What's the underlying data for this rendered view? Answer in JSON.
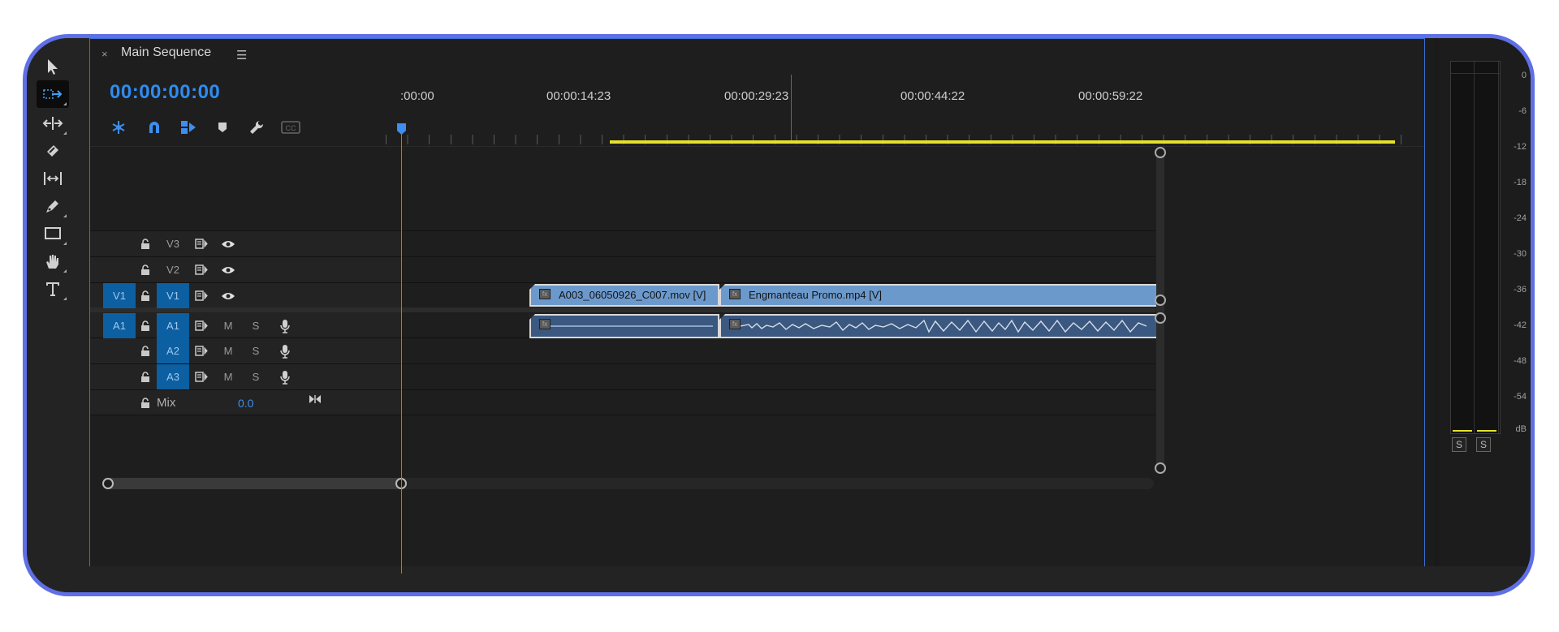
{
  "panel": {
    "close": "×",
    "title": "Main Sequence",
    "menu": "☰"
  },
  "timecode": "00:00:00:00",
  "ruler": {
    "ticks": [
      ":00:00",
      "00:00:14:23",
      "00:00:29:23",
      "00:00:44:22",
      "00:00:59:22"
    ]
  },
  "tracks": {
    "V3": {
      "label": "V3"
    },
    "V2": {
      "label": "V2"
    },
    "V1": {
      "src": "V1",
      "label": "V1"
    },
    "A1": {
      "src": "A1",
      "label": "A1",
      "m": "M",
      "s": "S"
    },
    "A2": {
      "label": "A2",
      "m": "M",
      "s": "S"
    },
    "A3": {
      "label": "A3",
      "m": "M",
      "s": "S"
    },
    "mix": {
      "label": "Mix",
      "value": "0.0"
    }
  },
  "clips": {
    "video": [
      {
        "name": "A003_06050926_C007.mov [V]"
      },
      {
        "name": "Engmanteau Promo.mp4 [V]"
      }
    ]
  },
  "meters": {
    "scale": [
      "0",
      "-6",
      "-12",
      "-18",
      "-24",
      "-30",
      "-36",
      "-42",
      "-48",
      "-54",
      "dB"
    ],
    "solo": [
      "S",
      "S"
    ]
  },
  "colors": {
    "accent": "#3d8ef0",
    "frame": "#5f6fe6",
    "work_area": "#e4e12a",
    "target": "#0c5fa0",
    "video_clip": "#6c99cc",
    "audio_clip": "#3a5880"
  }
}
